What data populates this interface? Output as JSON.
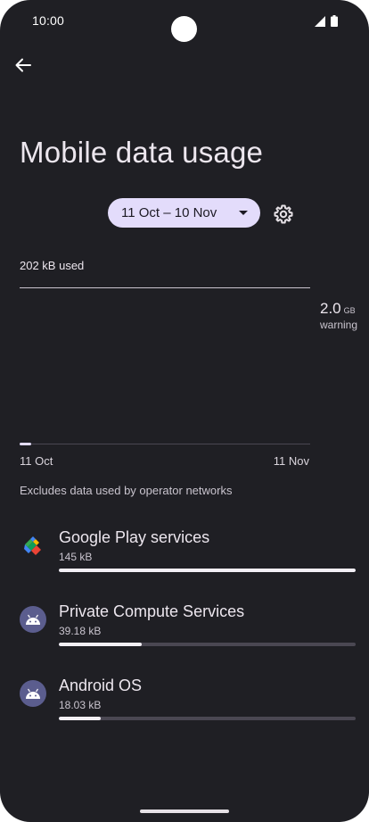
{
  "status_bar": {
    "time": "10:00",
    "icons": [
      "signal-icon",
      "battery-icon"
    ]
  },
  "header": {
    "back_icon": "arrow-left-icon",
    "title": "Mobile data usage"
  },
  "cycle": {
    "label": "11 Oct – 10 Nov",
    "icon": "chevron-down-icon",
    "settings_icon": "gear-icon"
  },
  "usage": {
    "total": "202 kB used",
    "warning_value": "2.0",
    "warning_unit": "GB",
    "warning_label": "warning",
    "start_date": "11 Oct",
    "end_date": "11 Nov",
    "progress_fraction": 0.04
  },
  "note": "Excludes data used by operator networks",
  "apps": [
    {
      "name": "Google Play services",
      "size": "145 kB",
      "fraction": 1.0,
      "icon": "google-play-services-icon"
    },
    {
      "name": "Private Compute Services",
      "size": "39.18 kB",
      "fraction": 0.28,
      "icon": "android-icon"
    },
    {
      "name": "Android OS",
      "size": "18.03 kB",
      "fraction": 0.14,
      "icon": "android-icon"
    }
  ],
  "colors": {
    "background": "#1f1f24",
    "accent": "#e3dcfb",
    "track": "#4a4752",
    "bar_fill": "#f2eff5",
    "android_icon_bg": "#5b5d8e"
  }
}
